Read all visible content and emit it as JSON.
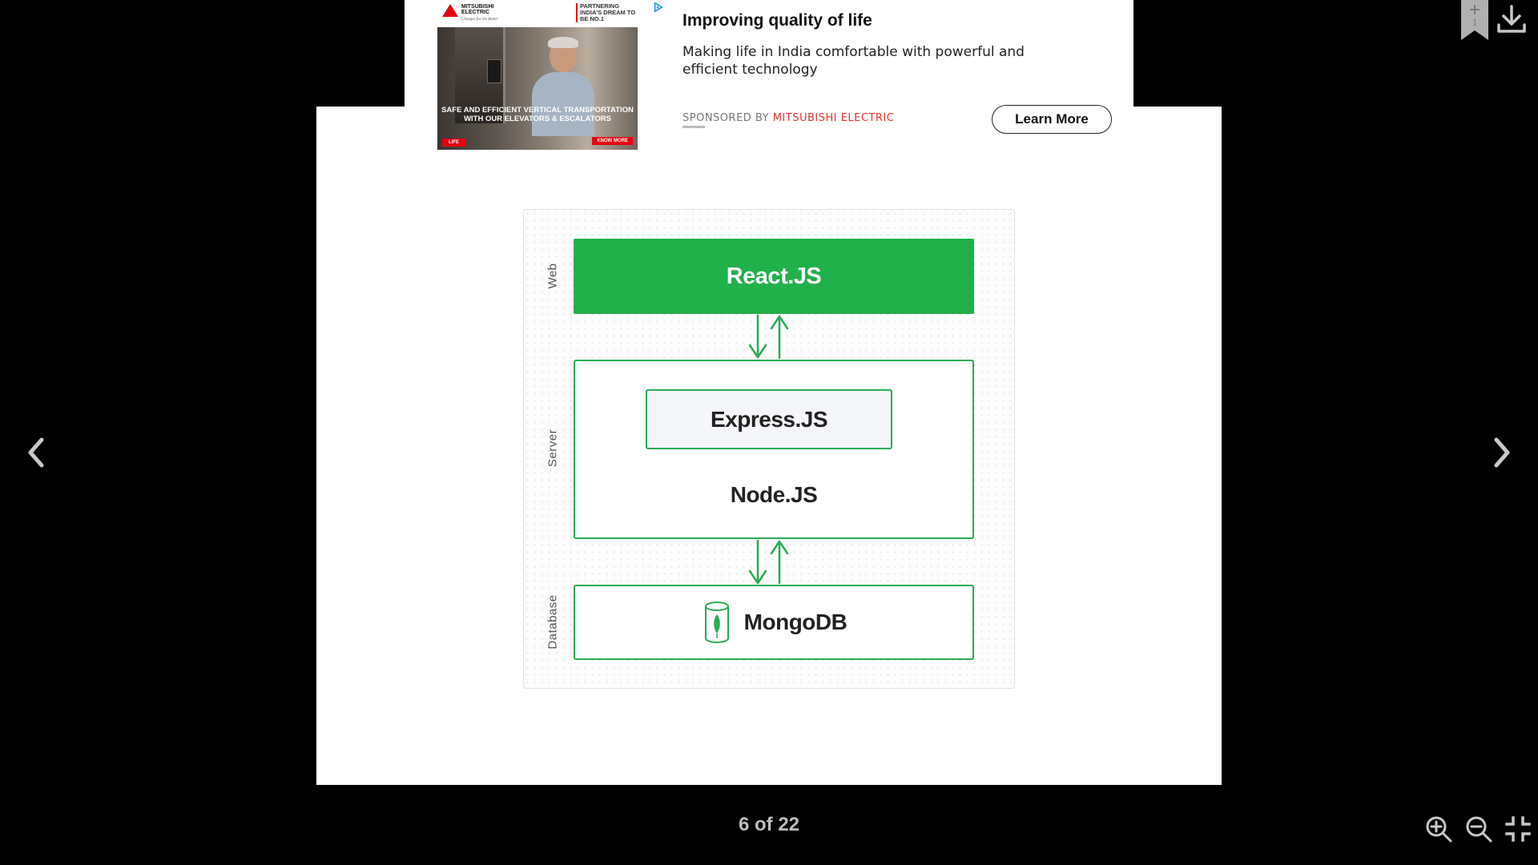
{
  "viewer": {
    "counter": "6 of 22",
    "bookmark_count": "1"
  },
  "ad": {
    "image": {
      "brand_logo_text": "MITSUBISHI ELECTRIC",
      "brand_tagline": "Changes for the Better",
      "partner_text": "PARTNERING INDIA'S DREAM TO BE NO.1",
      "caption": "SAFE AND EFFICIENT VERTICAL TRANSPORTATION WITH OUR ELEVATORS & ESCALATORS",
      "badge": "LIFE",
      "know_more": "KNOW MORE"
    },
    "title": "Improving quality of life",
    "description": "Making life in India comfortable with powerful and efficient technology",
    "sponsored_prefix": "SPONSORED BY",
    "sponsored_brand": "MITSUBISHI ELECTRIC",
    "cta": "Learn More"
  },
  "diagram": {
    "layers": {
      "web": "Web",
      "server": "Server",
      "database": "Database"
    },
    "boxes": {
      "react": "React.JS",
      "express": "Express.JS",
      "node": "Node.JS",
      "mongodb": "MongoDB"
    }
  },
  "colors": {
    "accent_green": "#21b14a",
    "border_green": "#2aab55",
    "brand_red": "#e60012",
    "sponsored_red": "#e0362c"
  }
}
